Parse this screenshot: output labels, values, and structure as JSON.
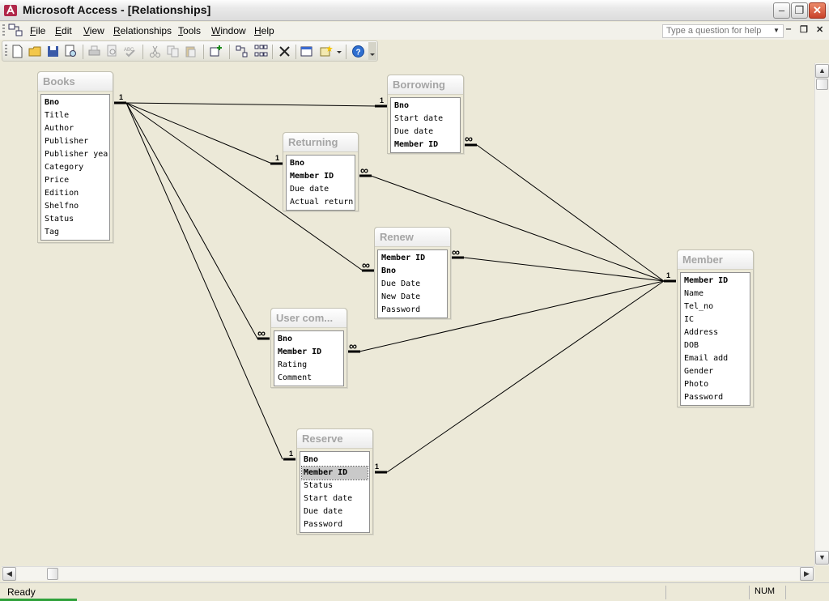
{
  "window": {
    "title": "Microsoft Access - [Relationships]"
  },
  "menu": {
    "items": [
      {
        "key": "F",
        "rest": "ile"
      },
      {
        "key": "E",
        "rest": "dit"
      },
      {
        "key": "V",
        "rest": "iew"
      },
      {
        "key": "R",
        "rest": "elationships"
      },
      {
        "key": "T",
        "rest": "ools"
      },
      {
        "key": "W",
        "rest": "indow"
      },
      {
        "key": "H",
        "rest": "elp"
      }
    ],
    "help_placeholder": "Type a question for help"
  },
  "tables": {
    "books": {
      "title": "Books",
      "fields": [
        "Bno",
        "Title",
        "Author",
        "Publisher",
        "Publisher year",
        "Category",
        "Price",
        "Edition",
        "Shelfno",
        "Status",
        "Tag"
      ]
    },
    "borrowing": {
      "title": "Borrowing",
      "fields": [
        "Bno",
        "Start date",
        "Due date",
        "Member ID"
      ]
    },
    "returning": {
      "title": "Returning",
      "fields": [
        "Bno",
        "Member ID",
        "Due date",
        "Actual return"
      ]
    },
    "renew": {
      "title": "Renew",
      "fields": [
        "Member ID",
        "Bno",
        "Due Date",
        "New Date",
        "Password"
      ]
    },
    "usercom": {
      "title": "User com...",
      "fields": [
        "Bno",
        "Member ID",
        "Rating",
        "Comment"
      ]
    },
    "reserve": {
      "title": "Reserve",
      "fields": [
        "Bno",
        "Member ID",
        "Status",
        "Start date",
        "Due date",
        "Password"
      ]
    },
    "member": {
      "title": "Member",
      "fields": [
        "Member ID",
        "Name",
        "Tel_no",
        "IC",
        "Address",
        "DOB",
        "Email add",
        "Gender",
        "Photo",
        "Password"
      ]
    }
  },
  "cardinality": {
    "one": "1",
    "many": "∞"
  },
  "status": {
    "text": "Ready",
    "num": "NUM"
  },
  "colors": {
    "title_text": "#a5a5a5",
    "canvas": "#ece9d8",
    "close_button": "#c9422a"
  }
}
